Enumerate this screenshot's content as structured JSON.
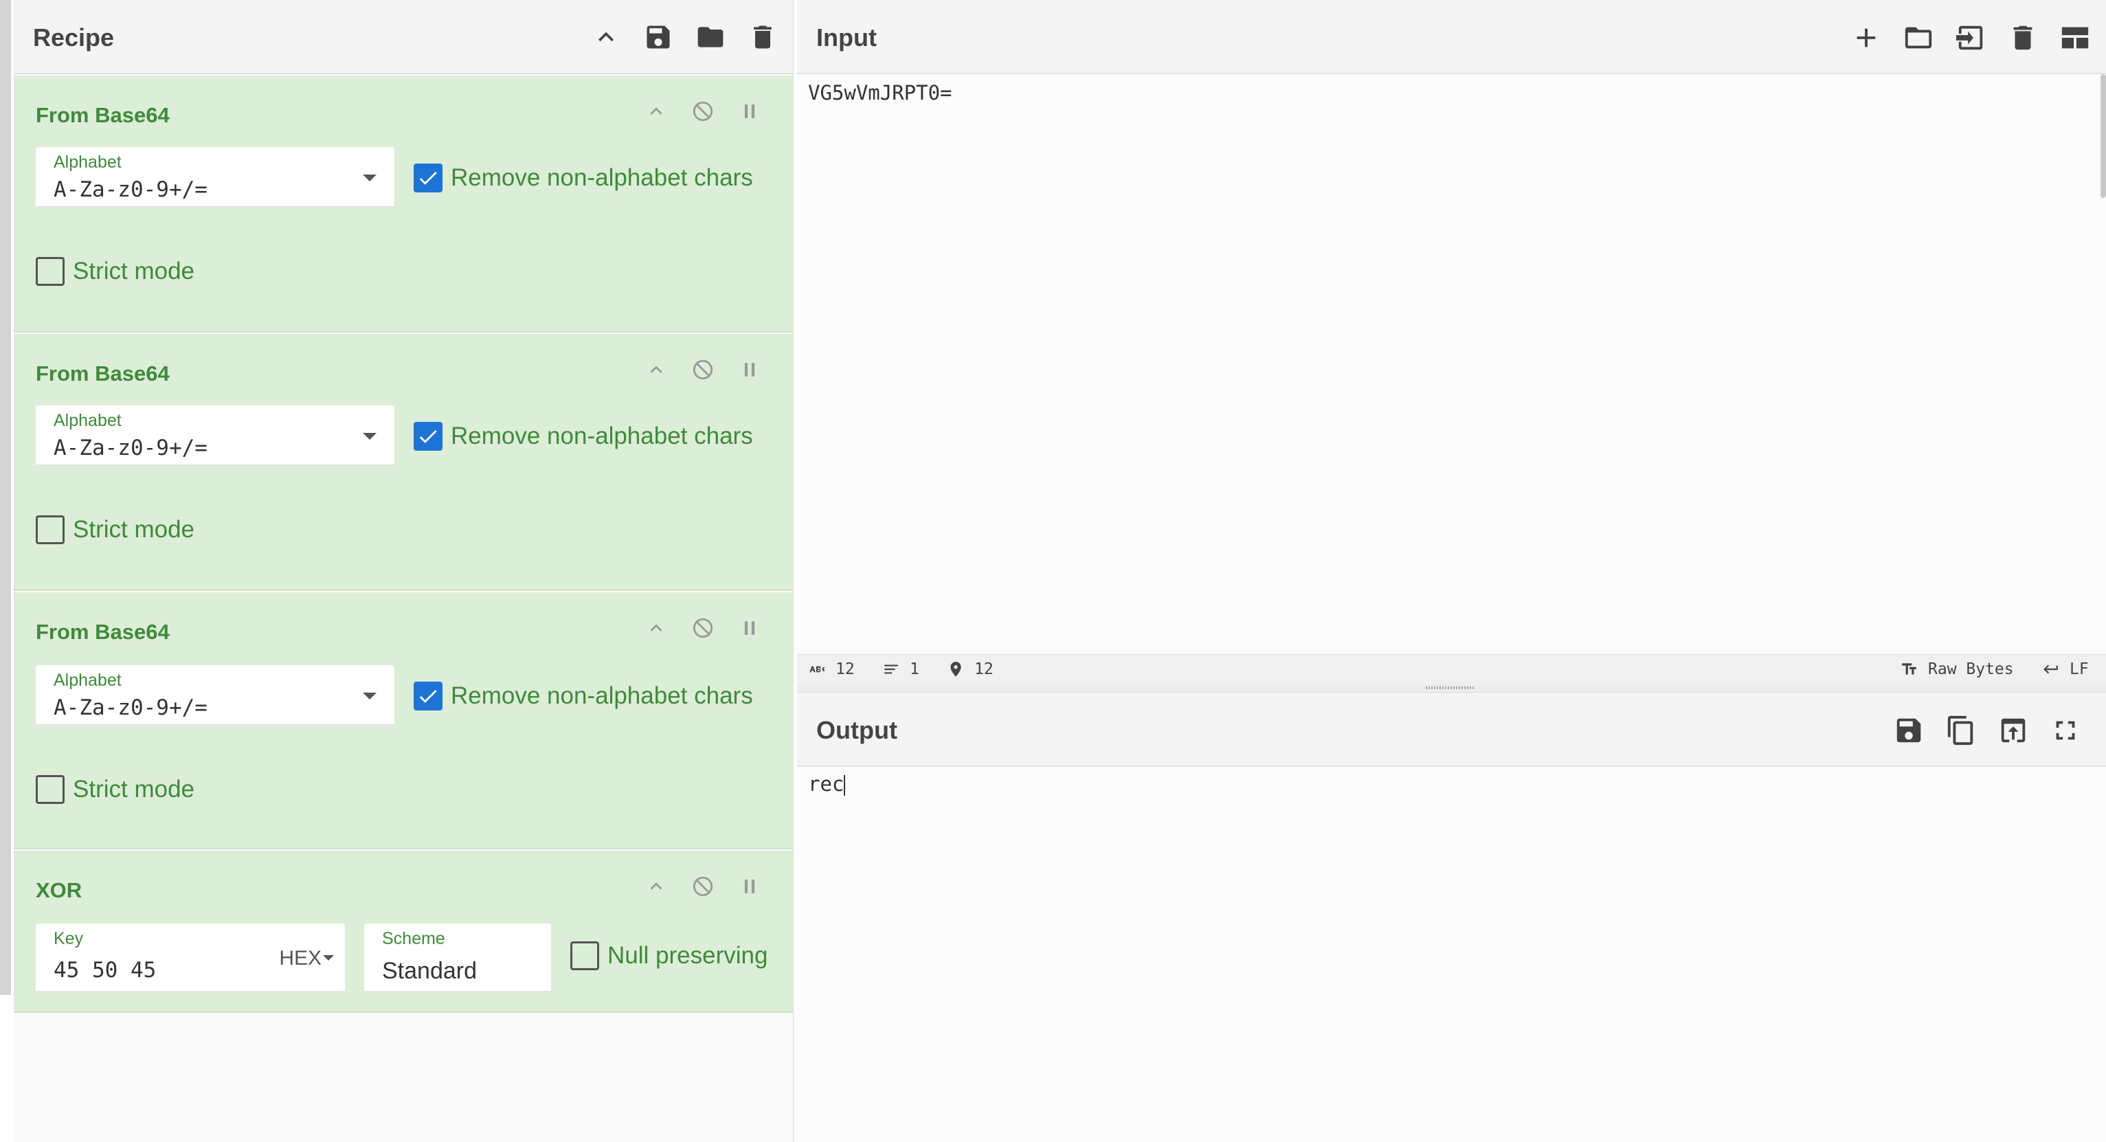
{
  "recipe": {
    "title": "Recipe",
    "operations": [
      {
        "title": "From Base64",
        "alphabet_label": "Alphabet",
        "alphabet_value": "A-Za-z0-9+/=",
        "remove_label": "Remove non-alphabet chars",
        "remove_checked": true,
        "strict_label": "Strict mode",
        "strict_checked": false
      },
      {
        "title": "From Base64",
        "alphabet_label": "Alphabet",
        "alphabet_value": "A-Za-z0-9+/=",
        "remove_label": "Remove non-alphabet chars",
        "remove_checked": true,
        "strict_label": "Strict mode",
        "strict_checked": false
      },
      {
        "title": "From Base64",
        "alphabet_label": "Alphabet",
        "alphabet_value": "A-Za-z0-9+/=",
        "remove_label": "Remove non-alphabet chars",
        "remove_checked": true,
        "strict_label": "Strict mode",
        "strict_checked": false
      }
    ],
    "xor": {
      "title": "XOR",
      "key_label": "Key",
      "key_value": "45 50 45",
      "key_format": "HEX",
      "scheme_label": "Scheme",
      "scheme_value": "Standard",
      "null_label": "Null preserving",
      "null_checked": false
    }
  },
  "input": {
    "title": "Input",
    "text": "VG5wVmJRPT0=",
    "status": {
      "length": "12",
      "lines": "1",
      "position": "12",
      "encoding": "Raw Bytes",
      "eol": "LF"
    }
  },
  "output": {
    "title": "Output",
    "text": "rec"
  },
  "colors": {
    "op_bg": "#dcedd8",
    "op_text": "#3f8a3a",
    "checkbox_on": "#1e73d6"
  }
}
